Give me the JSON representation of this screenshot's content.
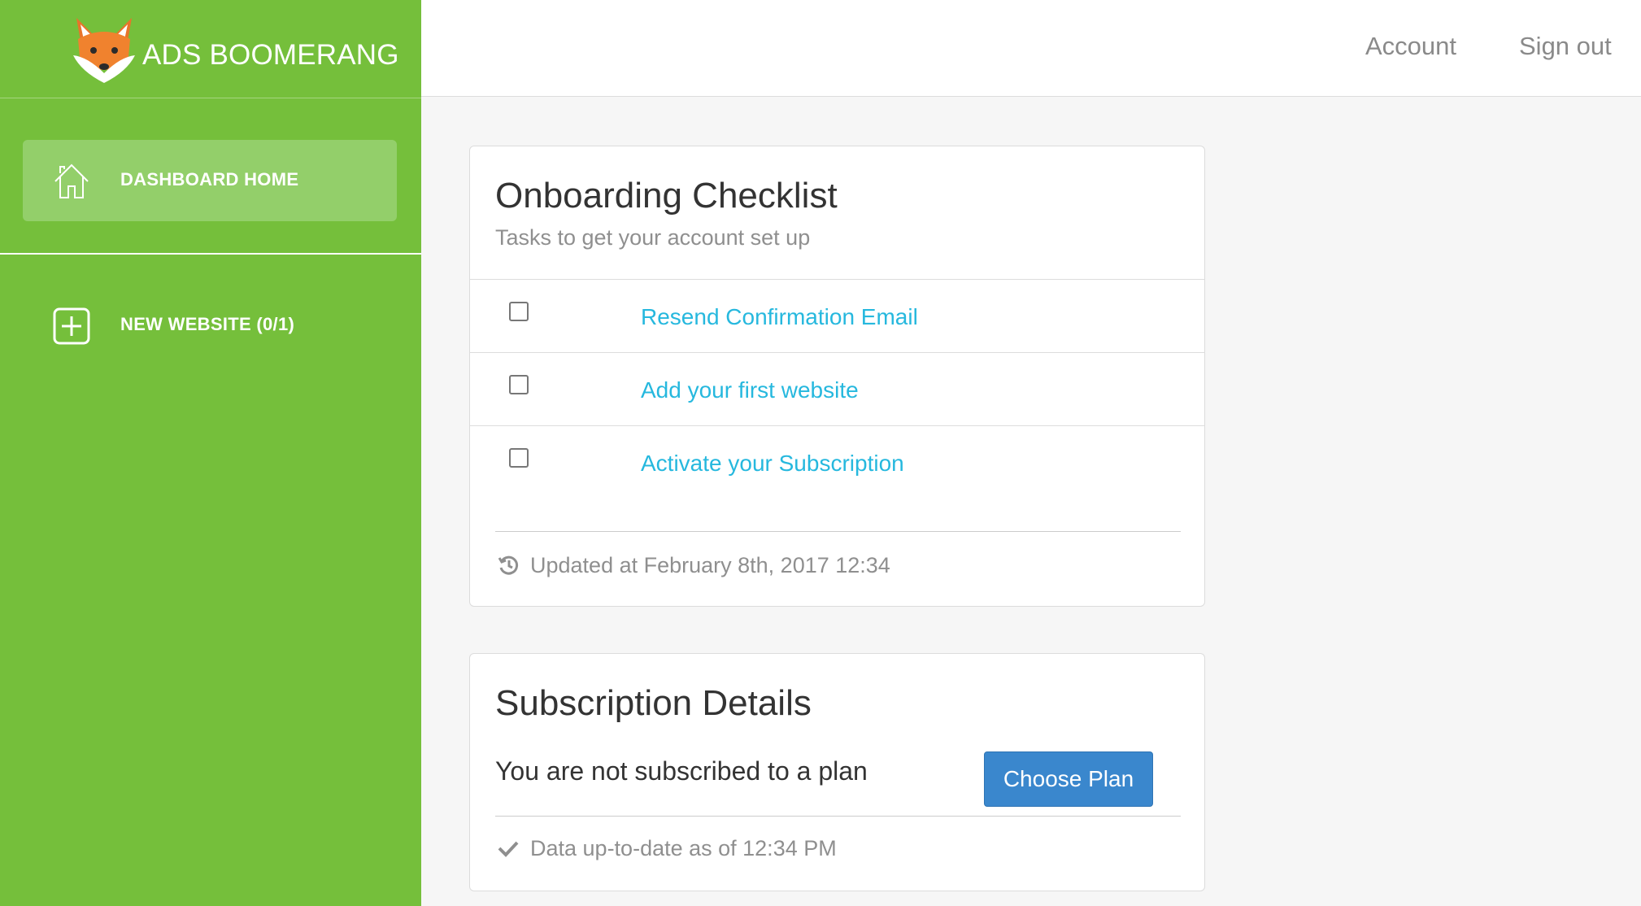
{
  "brand": {
    "name": "ADS BOOMERANG",
    "logo_icon": "fox-icon"
  },
  "sidebar": {
    "items": [
      {
        "label": "DASHBOARD HOME",
        "icon": "home-icon",
        "active": true
      },
      {
        "label": "NEW WEBSITE (0/1)",
        "icon": "plus-square-icon",
        "active": false
      }
    ]
  },
  "topbar": {
    "account": "Account",
    "signout": "Sign out"
  },
  "onboarding": {
    "title": "Onboarding Checklist",
    "subtitle": "Tasks to get your account set up",
    "tasks": [
      {
        "label": "Resend Confirmation Email",
        "checked": false
      },
      {
        "label": "Add your first website",
        "checked": false
      },
      {
        "label": "Activate your Subscription",
        "checked": false
      }
    ],
    "updated": "Updated at February 8th, 2017 12:34"
  },
  "subscription": {
    "title": "Subscription Details",
    "status": "You are not subscribed to a plan",
    "button": "Choose Plan",
    "footer": "Data up-to-date as of 12:34 PM"
  },
  "colors": {
    "sidebar": "#75bf3b",
    "sidebar_active": "#93cf6a",
    "link": "#26b8de",
    "primary_button": "#3a87cd"
  }
}
